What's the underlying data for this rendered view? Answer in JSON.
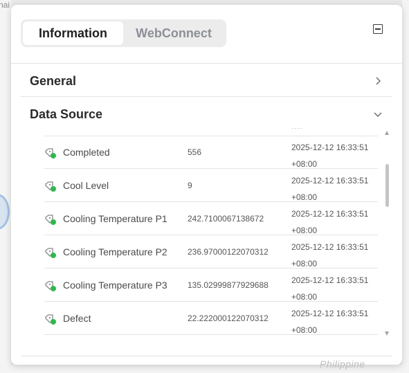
{
  "map": {
    "label_top_left": "nai",
    "label_bottom_right": "Philippine"
  },
  "panel": {
    "tabs": [
      {
        "label": "Information",
        "active": true
      },
      {
        "label": "WebConnect",
        "active": false
      }
    ],
    "collapse_icon": "minus-square-icon",
    "sections": {
      "general": {
        "title": "General",
        "icon": "chevron-right-icon",
        "expanded": false
      },
      "data_source": {
        "title": "Data Source",
        "icon": "chevron-down-icon",
        "expanded": true
      }
    },
    "data_source_rows": [
      {
        "name": "Completed",
        "value": "556",
        "time_line1": "2025-12-12 16:33:51",
        "time_line2": "+08:00"
      },
      {
        "name": "Cool Level",
        "value": "9",
        "time_line1": "2025-12-12 16:33:51",
        "time_line2": "+08:00"
      },
      {
        "name": "Cooling Temperature P1",
        "value": "242.7100067138672",
        "time_line1": "2025-12-12 16:33:51",
        "time_line2": "+08:00"
      },
      {
        "name": "Cooling Temperature P2",
        "value": "236.97000122070312",
        "time_line1": "2025-12-12 16:33:51",
        "time_line2": "+08:00"
      },
      {
        "name": "Cooling Temperature P3",
        "value": "135.02999877929688",
        "time_line1": "2025-12-12 16:33:51",
        "time_line2": "+08:00"
      },
      {
        "name": "Defect",
        "value": "22.222000122070312",
        "time_line1": "2025-12-12 16:33:51",
        "time_line2": "+08:00"
      }
    ],
    "row_icon": "tag-connected-icon",
    "colors": {
      "status_green": "#2fb84e",
      "tab_active_bg": "#ffffff",
      "tab_track_bg": "#ececec",
      "inactive_tab_text": "#8b8f96"
    }
  }
}
